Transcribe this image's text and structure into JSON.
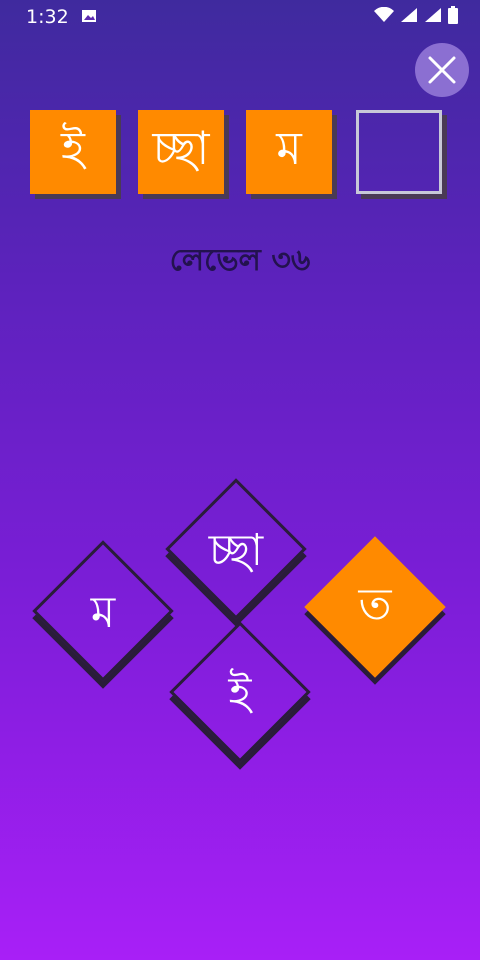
{
  "status_bar": {
    "time": "1:32"
  },
  "answer_slots": [
    {
      "letter": "ই",
      "state": "filled"
    },
    {
      "letter": "চ্ছা",
      "state": "filled"
    },
    {
      "letter": "ম",
      "state": "filled"
    },
    {
      "letter": "",
      "state": "empty"
    }
  ],
  "level": {
    "label": "লেভেল ৩৬"
  },
  "tiles": [
    {
      "letter": "চ্ছা",
      "style": "outline"
    },
    {
      "letter": "ম",
      "style": "outline"
    },
    {
      "letter": "ত",
      "style": "orange"
    },
    {
      "letter": "ই",
      "style": "outline"
    }
  ],
  "colors": {
    "accent": "#ff8a00",
    "outline": "#2a1c3a",
    "level_text": "#23124f"
  }
}
